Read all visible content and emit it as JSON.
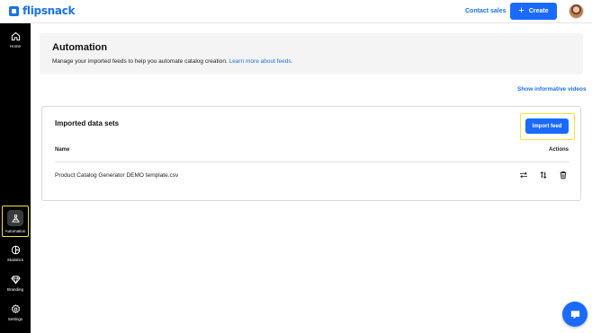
{
  "brand": {
    "name": "flipsnack",
    "color": "#1a73e8"
  },
  "topbar": {
    "contact_sales": "Contact sales",
    "create_label": "Create",
    "create_icon": "plus"
  },
  "sidebar": {
    "items": [
      {
        "label": "Home",
        "icon": "home-icon",
        "active": false
      },
      {
        "label": "Automation",
        "icon": "automation-icon",
        "active": true
      },
      {
        "label": "Statistics",
        "icon": "statistics-icon",
        "active": false
      },
      {
        "label": "Branding",
        "icon": "diamond-icon",
        "active": false
      },
      {
        "label": "Settings",
        "icon": "gear-icon",
        "active": false
      }
    ]
  },
  "header": {
    "title": "Automation",
    "description": "Manage your imported feeds to help you automate catalog creation.",
    "learn_more": "Learn more about feeds."
  },
  "show_videos": "Show informative videos",
  "datasets": {
    "title": "Imported data sets",
    "import_button": "Import feed",
    "columns": {
      "name": "Name",
      "actions": "Actions"
    },
    "rows": [
      {
        "name": "Product Catalog Generator DEMO template.csv",
        "actions": [
          "repeat-icon",
          "sort-arrows-icon",
          "trash-icon"
        ]
      }
    ]
  },
  "colors": {
    "accent": "#1a6aff",
    "highlight": "#f2e53a",
    "sidebar": "#000000"
  }
}
